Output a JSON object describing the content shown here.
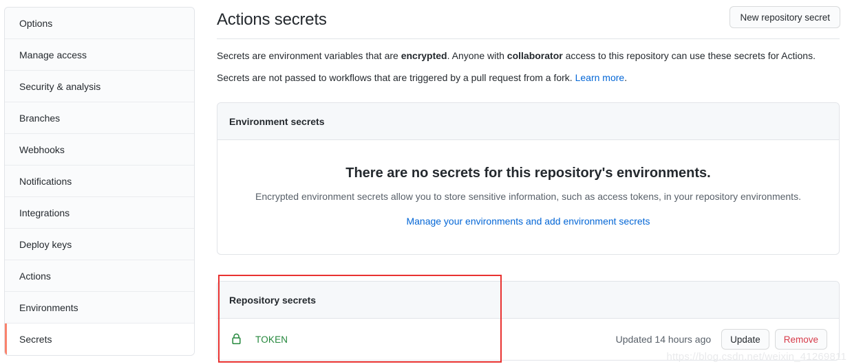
{
  "sidebar": {
    "items": [
      {
        "label": "Options",
        "active": false
      },
      {
        "label": "Manage access",
        "active": false
      },
      {
        "label": "Security & analysis",
        "active": false
      },
      {
        "label": "Branches",
        "active": false
      },
      {
        "label": "Webhooks",
        "active": false
      },
      {
        "label": "Notifications",
        "active": false
      },
      {
        "label": "Integrations",
        "active": false
      },
      {
        "label": "Deploy keys",
        "active": false
      },
      {
        "label": "Actions",
        "active": false
      },
      {
        "label": "Environments",
        "active": false
      },
      {
        "label": "Secrets",
        "active": true
      }
    ]
  },
  "header": {
    "title": "Actions secrets",
    "new_secret_button": "New repository secret"
  },
  "description": {
    "line1_part1": "Secrets are environment variables that are ",
    "line1_bold1": "encrypted",
    "line1_part2": ". Anyone with ",
    "line1_bold2": "collaborator",
    "line1_part3": " access to this repository can use these secrets for Actions.",
    "line2_part1": "Secrets are not passed to workflows that are triggered by a pull request from a fork. ",
    "line2_link": "Learn more",
    "line2_part2": "."
  },
  "environment_secrets": {
    "panel_title": "Environment secrets",
    "empty_title": "There are no secrets for this repository's environments.",
    "empty_subtitle": "Encrypted environment secrets allow you to store sensitive information, such as access tokens, in your repository environments.",
    "empty_link": "Manage your environments and add environment secrets"
  },
  "repository_secrets": {
    "panel_title": "Repository secrets",
    "rows": [
      {
        "icon": "lock-icon",
        "name": "TOKEN",
        "updated": "Updated 14 hours ago",
        "update_label": "Update",
        "remove_label": "Remove"
      }
    ]
  },
  "annotation": {
    "color": "#e8312f"
  },
  "watermark": {
    "text": "https://blog.csdn.net/weixin_41269811"
  },
  "colors": {
    "accent": "#0366d6",
    "secret_green": "#22863a",
    "danger": "#d73a49",
    "active_bar": "#f9826c",
    "border": "#e1e4e8",
    "panel_head_bg": "#f6f8fa"
  }
}
